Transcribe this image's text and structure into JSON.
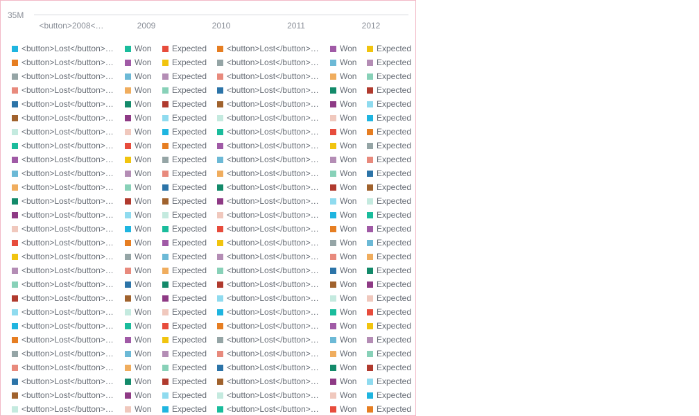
{
  "chart_data": {
    "type": "bar",
    "y_tick_label": "35M",
    "categories": [
      "<button>2008</button>",
      "2009",
      "2010",
      "2011",
      "2012"
    ],
    "colors": [
      "#1fb5e0",
      "#1abc9c",
      "#e74c3c",
      "#e67e22",
      "#a05aa6",
      "#f1c40f",
      "#95a5a6",
      "#6cb9d6",
      "#b48db5",
      "#e88a7d",
      "#f0ad5e",
      "#88d1b8",
      "#2c74a8",
      "#138a6a",
      "#b03a2e",
      "#a0622d",
      "#8e3a85",
      "#8fdbef",
      "#c4eadf",
      "#f0c8bd"
    ],
    "legend_rows": [
      [
        "<button>Lost</button> …",
        "Won",
        "Expected",
        "<button>Lost</button> …",
        "Won",
        "Expected"
      ]
    ],
    "legend_row_count": 27
  }
}
